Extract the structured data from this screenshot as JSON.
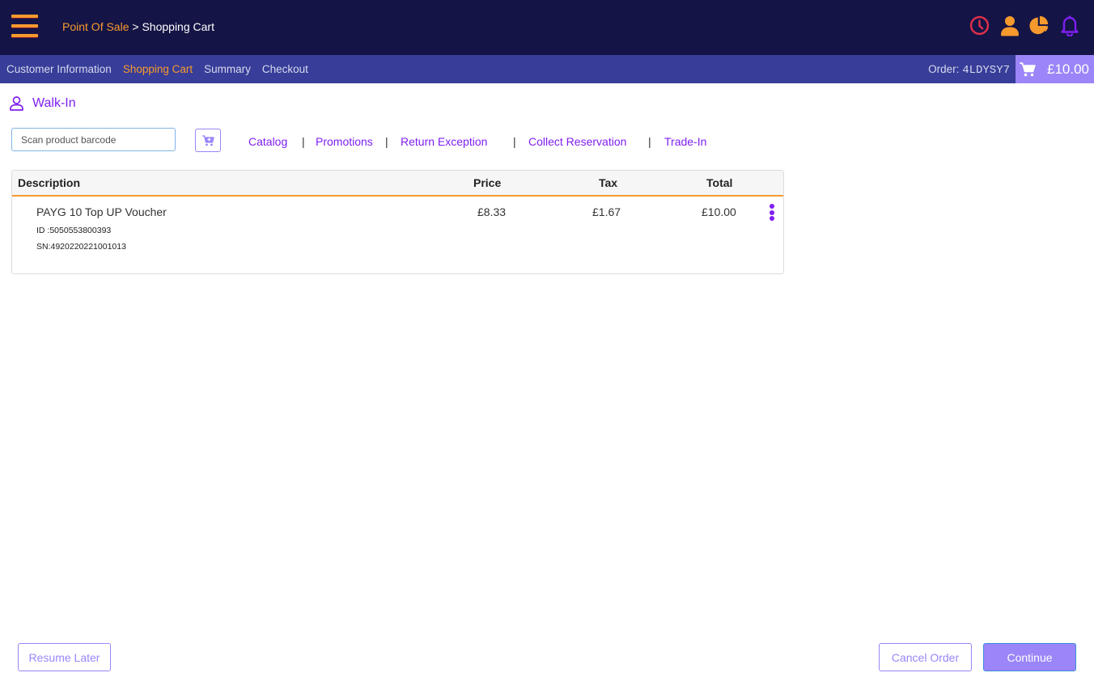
{
  "header": {
    "breadcrumb": {
      "root": "Point Of Sale",
      "separator": " > ",
      "current": "Shopping Cart"
    },
    "icons": [
      "clock-icon",
      "user-icon",
      "pie-chart-icon",
      "bell-icon"
    ],
    "colors": {
      "topbar": "#141446",
      "navbar": "#373d98",
      "accent_orange": "#f79a2e",
      "accent_purple": "#7f1ef2",
      "button_purple": "#9b85f8",
      "clock_red": "#dc2f4a"
    }
  },
  "nav": {
    "tabs": [
      {
        "label": "Customer Information",
        "active": false
      },
      {
        "label": "Shopping Cart",
        "active": true
      },
      {
        "label": "Summary",
        "active": false
      },
      {
        "label": "Checkout",
        "active": false
      }
    ],
    "order_label": "Order:",
    "order_id": "4LDYSY7",
    "cart_total": "£10.00"
  },
  "customer": {
    "name": "Walk-In"
  },
  "scan": {
    "placeholder": "Scan product barcode",
    "value": ""
  },
  "actions": [
    "Catalog",
    "Promotions",
    "Return Exception",
    "Collect Reservation",
    "Trade-In"
  ],
  "table": {
    "headers": {
      "description": "Description",
      "price": "Price",
      "tax": "Tax",
      "total": "Total"
    },
    "rows": [
      {
        "description": "PAYG 10 Top UP Voucher",
        "id": "ID :5050553800393",
        "sn": "SN:4920220221001013",
        "price": "£8.33",
        "tax": "£1.67",
        "total": "£10.00"
      }
    ]
  },
  "footer": {
    "resume_later": "Resume Later",
    "cancel_order": "Cancel Order",
    "continue": "Continue"
  }
}
